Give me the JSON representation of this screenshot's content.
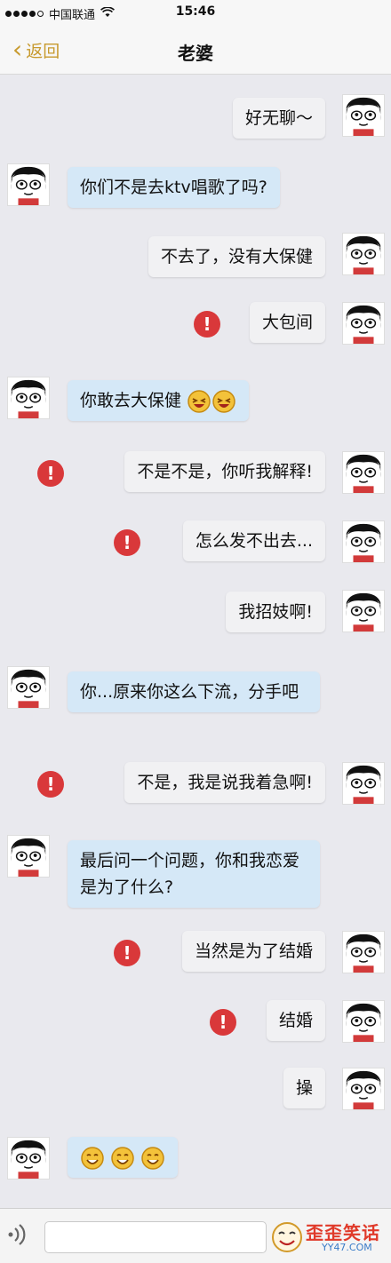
{
  "status_bar": {
    "carrier": "中国联通",
    "time": "15:46"
  },
  "nav": {
    "back_label": "返回",
    "title": "老婆"
  },
  "messages": [
    {
      "from": "me",
      "text": "好无聊～",
      "failed": false
    },
    {
      "from": "other",
      "text": "你们不是去ktv唱歌了吗?",
      "failed": false
    },
    {
      "from": "me",
      "text": "不去了，没有大保健",
      "failed": false
    },
    {
      "from": "me",
      "text": "大包间",
      "failed": true
    },
    {
      "from": "other",
      "text": "你敢去大保健",
      "emoji": [
        "laugh-emoji",
        "laugh-emoji"
      ],
      "failed": false
    },
    {
      "from": "me",
      "text": "不是不是，你听我解释!",
      "failed": true
    },
    {
      "from": "me",
      "text": "怎么发不出去...",
      "failed": true
    },
    {
      "from": "me",
      "text": "我招妓啊!",
      "failed": false
    },
    {
      "from": "other",
      "text": "你...原来你这么下流，分手吧",
      "failed": false
    },
    {
      "from": "me",
      "text": "不是，我是说我着急啊!",
      "failed": true
    },
    {
      "from": "other",
      "text": "最后问一个问题，你和我恋爱是为了什么?",
      "failed": false
    },
    {
      "from": "me",
      "text": "当然是为了结婚",
      "failed": true
    },
    {
      "from": "me",
      "text": "结婚",
      "failed": true
    },
    {
      "from": "me",
      "text": "操",
      "failed": false
    },
    {
      "from": "other",
      "text": "",
      "emoji": [
        "grin-emoji",
        "grin-emoji",
        "grin-emoji"
      ],
      "failed": false
    }
  ],
  "error_glyph": "!",
  "watermark": {
    "text": "歪歪笑话",
    "url": "YY47.COM"
  },
  "colors": {
    "back_accent": "#c79a2e",
    "my_bubble": "#f1f1f3",
    "other_bubble": "#d5e8f7",
    "error_red": "#d9383a"
  }
}
